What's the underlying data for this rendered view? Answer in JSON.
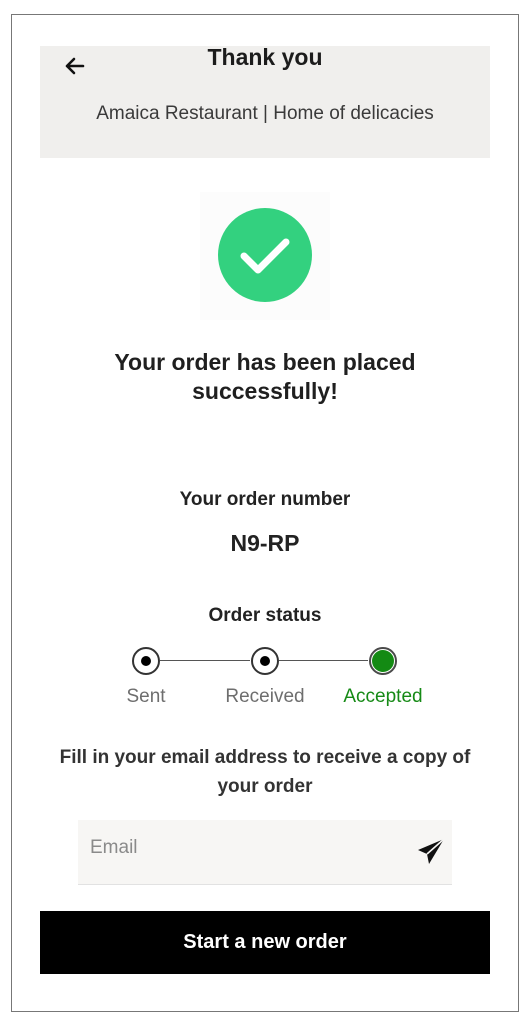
{
  "header": {
    "back_icon": "arrow-left-icon",
    "title": "Thank you",
    "subtitle": "Amaica Restaurant | Home of delicacies"
  },
  "success": {
    "icon": "check-circle-icon",
    "icon_color": "#33d17f",
    "message": "Your order has been placed successfully!"
  },
  "order": {
    "number_label": "Your order number",
    "number": "N9-RP"
  },
  "status": {
    "label": "Order status",
    "steps": [
      {
        "label": "Sent",
        "state": "done"
      },
      {
        "label": "Received",
        "state": "done"
      },
      {
        "label": "Accepted",
        "state": "current"
      }
    ],
    "current_color": "#138a13"
  },
  "email": {
    "prompt": "Fill in your email address to receive a copy of your order",
    "placeholder": "Email",
    "value": "",
    "send_icon": "paper-plane-icon"
  },
  "actions": {
    "new_order_label": "Start a new order"
  }
}
